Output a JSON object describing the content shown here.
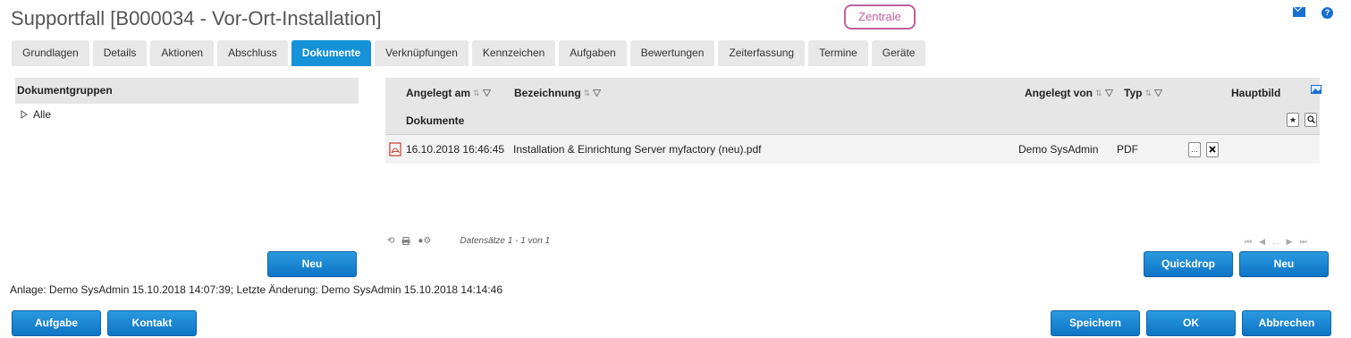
{
  "header": {
    "title": "Supportfall [B000034 - Vor-Ort-Installation]",
    "badge": "Zentrale",
    "icons": [
      "mail-icon",
      "help-icon"
    ]
  },
  "tabs": [
    {
      "label": "Grundlagen",
      "active": false
    },
    {
      "label": "Details",
      "active": false
    },
    {
      "label": "Aktionen",
      "active": false
    },
    {
      "label": "Abschluss",
      "active": false
    },
    {
      "label": "Dokumente",
      "active": true
    },
    {
      "label": "Verknüpfungen",
      "active": false
    },
    {
      "label": "Kennzeichen",
      "active": false
    },
    {
      "label": "Aufgaben",
      "active": false
    },
    {
      "label": "Bewertungen",
      "active": false
    },
    {
      "label": "Zeiterfassung",
      "active": false
    },
    {
      "label": "Termine",
      "active": false
    },
    {
      "label": "Geräte",
      "active": false
    }
  ],
  "left_panel": {
    "header": "Dokumentgruppen",
    "tree": [
      {
        "label": "Alle"
      }
    ],
    "new_button": "Neu"
  },
  "grid": {
    "columns": {
      "created_at": "Angelegt am",
      "name": "Bezeichnung",
      "created_by": "Angelegt von",
      "type": "Typ",
      "main_image": "Hauptbild"
    },
    "group_label": "Dokumente",
    "rows": [
      {
        "created_at": "16.10.2018 16:46:45",
        "name": "Installation & Einrichtung Server myfactory (neu).pdf",
        "created_by": "Demo SysAdmin",
        "type": "PDF"
      }
    ],
    "pager_info": "Datensätze 1 - 1 von 1",
    "pager_dots": "...",
    "quickdrop_button": "Quickdrop",
    "new_button": "Neu"
  },
  "meta": "Anlage: Demo SysAdmin 15.10.2018 14:07:39; Letzte Änderung: Demo SysAdmin 15.10.2018 14:14:46",
  "footer": {
    "task_button": "Aufgabe",
    "contact_button": "Kontakt",
    "save_button": "Speichern",
    "ok_button": "OK",
    "cancel_button": "Abbrechen"
  },
  "colors": {
    "accent": "#1592d8",
    "badge": "#c0629b"
  }
}
